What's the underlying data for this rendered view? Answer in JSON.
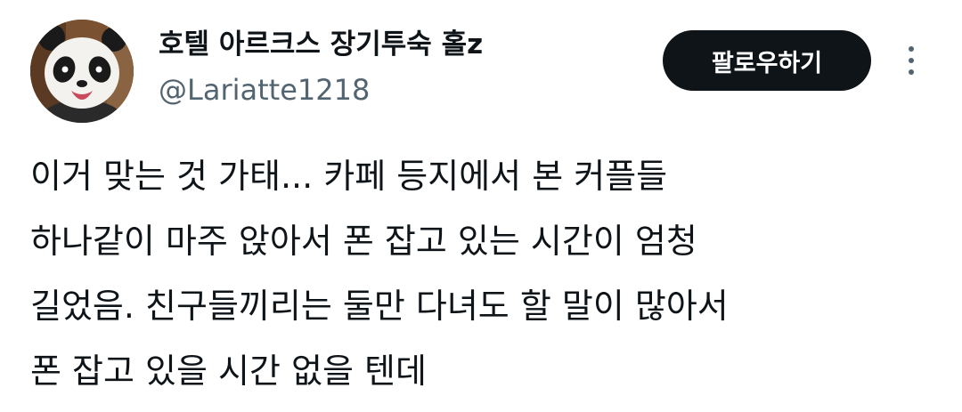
{
  "author": {
    "display_name": "호텔 아르크스 장기투숙 홀z",
    "handle": "@Lariatte1218",
    "avatar_icon": "panda-avatar-icon"
  },
  "actions": {
    "follow_label": "팔로우하기",
    "more_icon": "more-vertical-icon"
  },
  "tweet": {
    "lines": [
      "이거 맞는 것 가태... 카페 등지에서 본 커플들",
      "하나같이 마주 앉아서 폰 잡고 있는 시간이 엄청",
      "길었음. 친구들끼리는 둘만 다녀도 할 말이 많아서",
      "폰 잡고 있을 시간 없을 텐데"
    ]
  },
  "colors": {
    "text": "#0f1419",
    "secondary": "#536471",
    "button_bg": "#0f1419",
    "button_text": "#ffffff"
  }
}
